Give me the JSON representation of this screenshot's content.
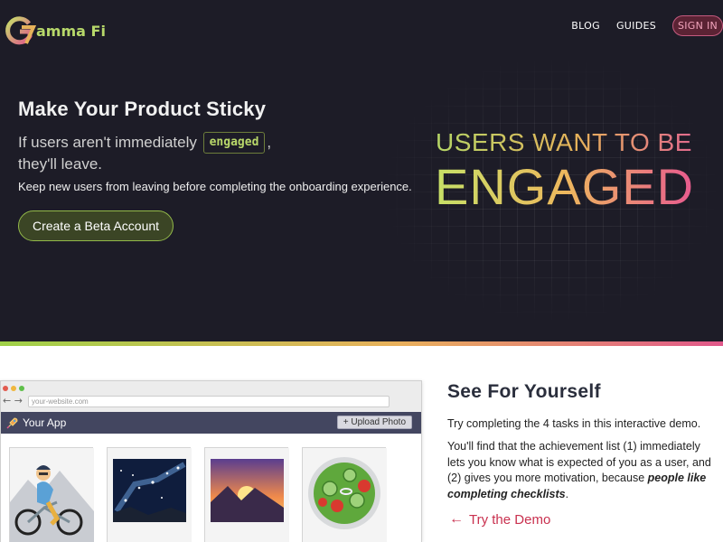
{
  "header": {
    "logo_text": "amma Fi",
    "nav": {
      "blog": "BLOG",
      "guides": "GUIDES",
      "sign_in": "SIGN IN"
    }
  },
  "hero": {
    "title": "Make Your Product Sticky",
    "subtitle_before": "If users aren't immediately",
    "subtitle_chip": "engaged",
    "subtitle_after": ",",
    "subtitle_line2": "they'll leave.",
    "description": "Keep new users from leaving before completing the onboarding experience.",
    "cta": "Create a Beta Account",
    "tagline_small": "USERS WANT TO BE",
    "tagline_big": "ENGAGED"
  },
  "demo_app": {
    "url": "your-website.com",
    "app_title": "Your App",
    "upload_button": "+ Upload Photo",
    "photos": [
      "cyclist-photo",
      "night-sky-photo",
      "sunset-mountain-photo",
      "salad-photo"
    ]
  },
  "see_for_yourself": {
    "title": "See For Yourself",
    "intro": "Try completing the 4 tasks in this interactive demo.",
    "body_plain": "You'll find that the achievement list (1) immediately lets you know what is expected of you as a user, and (2) gives you more motivation, because ",
    "body_emphasis": "people like completing checklists",
    "body_end": ".",
    "link": "Try the Demo"
  },
  "colors": {
    "hero_bg": "#1d1c27",
    "accent_green": "#b9d86a",
    "accent_pink": "#e0588a",
    "app_bar": "#434660",
    "link_red": "#c9314f"
  }
}
